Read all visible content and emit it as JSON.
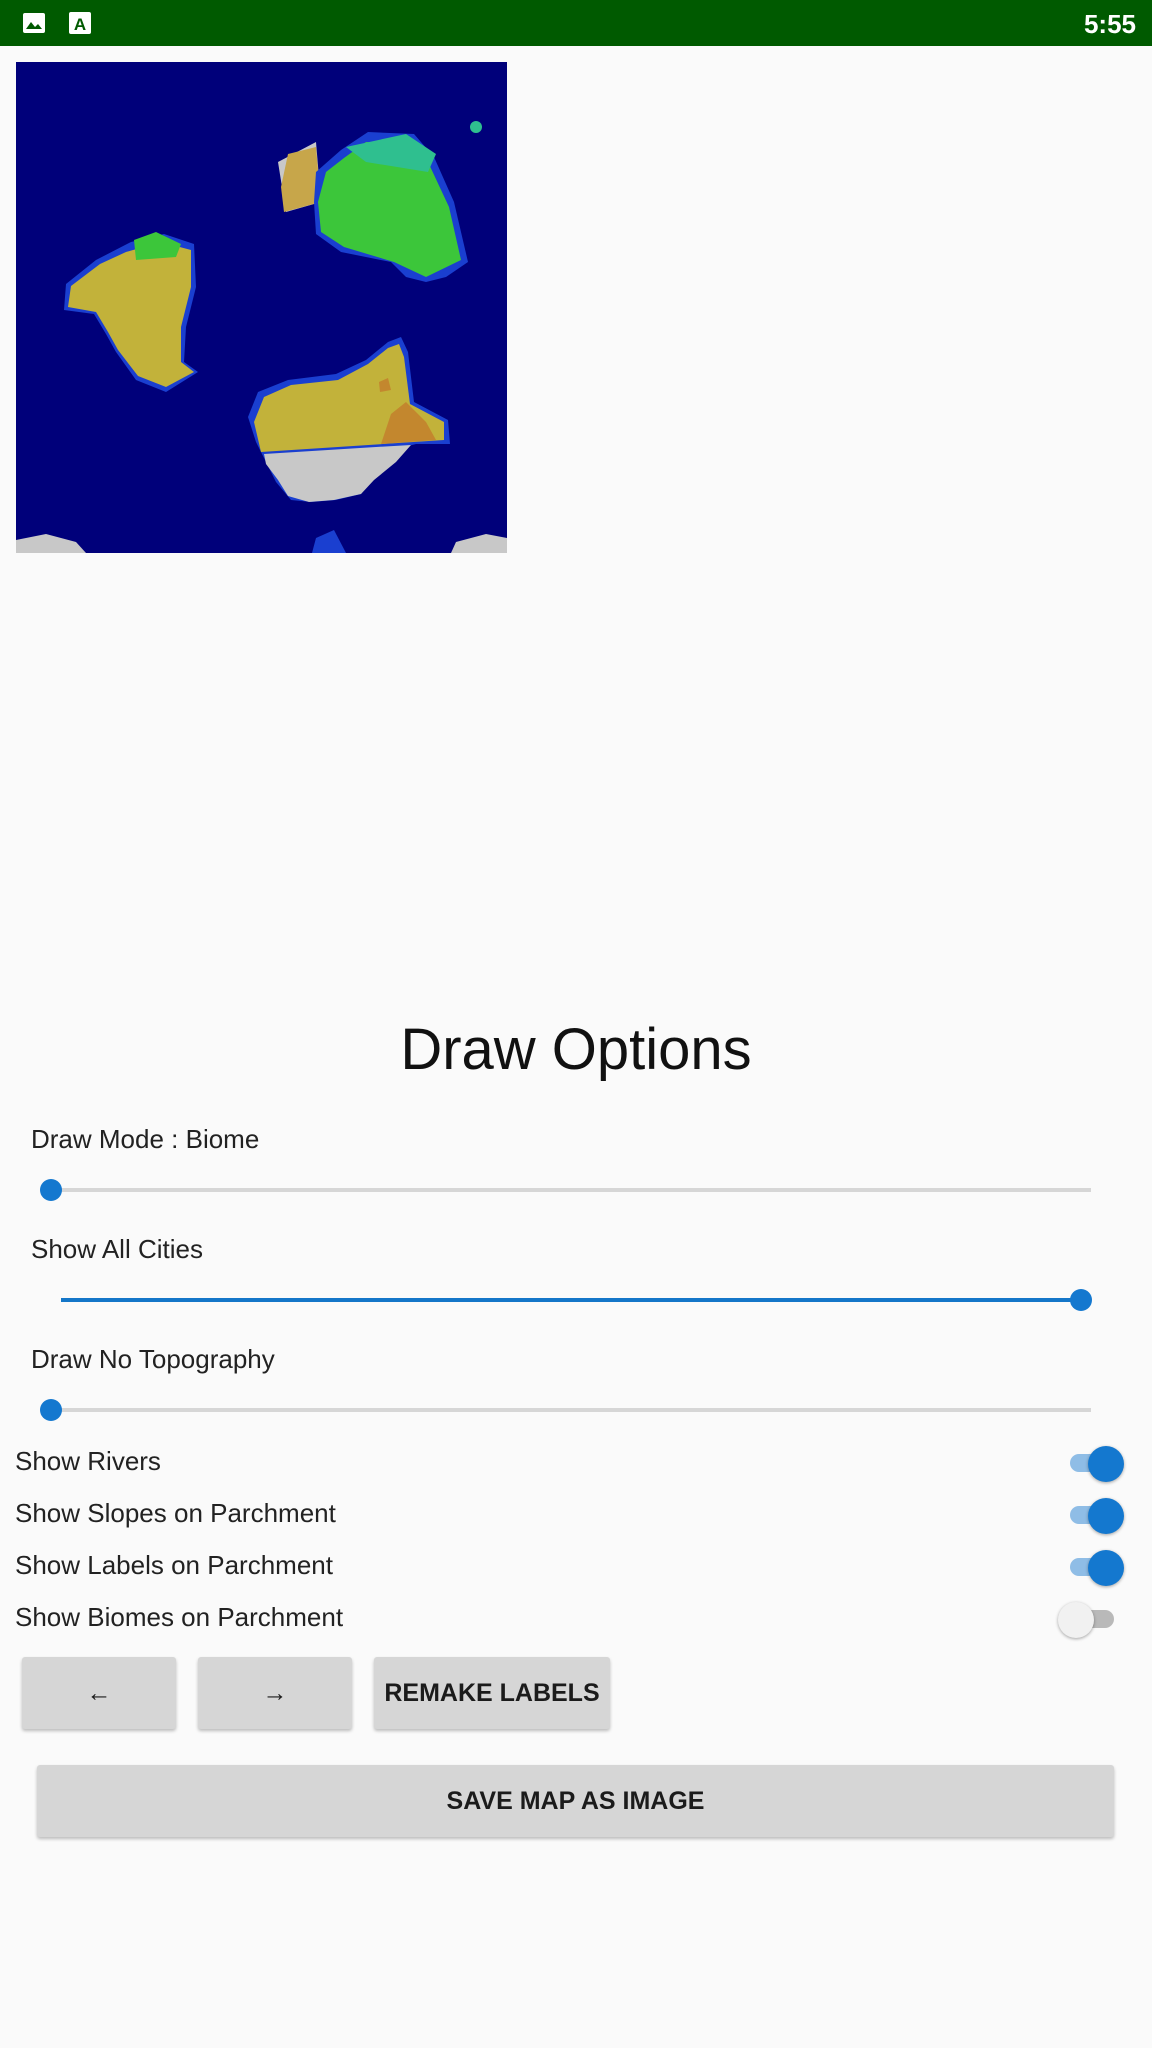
{
  "status_bar": {
    "time": "5:55",
    "icons": [
      "image-icon",
      "a-icon"
    ],
    "background": "#005a00"
  },
  "map": {
    "colors": {
      "ocean": "#00007a",
      "shore": "#1a3fd0",
      "desert": "#c2b23a",
      "grass": "#3cc63a",
      "ice": "#c8c8c8",
      "mountain": "#c3872e"
    }
  },
  "draw_options": {
    "title": "Draw Options",
    "sliders": [
      {
        "label": "Draw Mode : Biome",
        "value": 0.0
      },
      {
        "label": "Show All Cities",
        "value": 1.0
      },
      {
        "label": "Draw No Topography",
        "value": 0.0
      }
    ],
    "switches": [
      {
        "label": "Show Rivers",
        "on": true
      },
      {
        "label": "Show Slopes on Parchment",
        "on": true
      },
      {
        "label": "Show Labels on Parchment",
        "on": true
      },
      {
        "label": "Show Biomes on Parchment",
        "on": false
      }
    ],
    "buttons": {
      "prev": "←",
      "next": "→",
      "remake": "REMAKE LABELS",
      "save": "SAVE MAP AS IMAGE"
    },
    "accent": "#1478cf"
  }
}
